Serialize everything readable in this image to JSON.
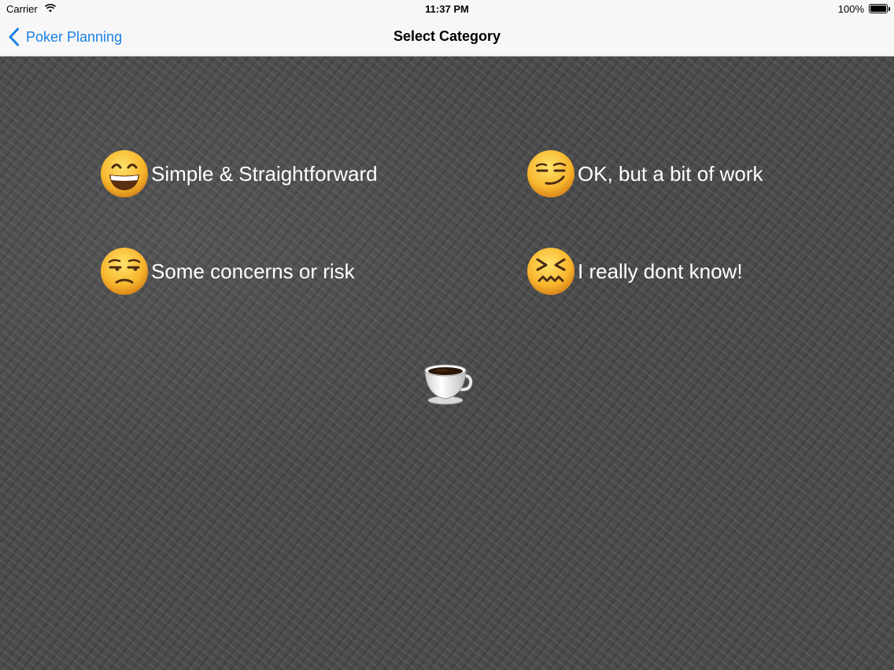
{
  "status_bar": {
    "carrier": "Carrier",
    "time": "11:37 PM",
    "battery": "100%"
  },
  "nav": {
    "back_label": "Poker Planning",
    "title": "Select Category"
  },
  "categories": [
    {
      "label": "Simple & Straightforward",
      "icon": "grinning-face-icon"
    },
    {
      "label": "OK, but a bit of work",
      "icon": "smirking-face-icon"
    },
    {
      "label": "Some concerns or risk",
      "icon": "unamused-face-icon"
    },
    {
      "label": "I really dont know!",
      "icon": "confounded-face-icon"
    }
  ],
  "coffee": {
    "icon": "coffee-cup-icon"
  },
  "colors": {
    "accent": "#1a7fe6",
    "background": "#4b4b4b",
    "bar": "#f7f7f7",
    "label": "#ffffff"
  }
}
